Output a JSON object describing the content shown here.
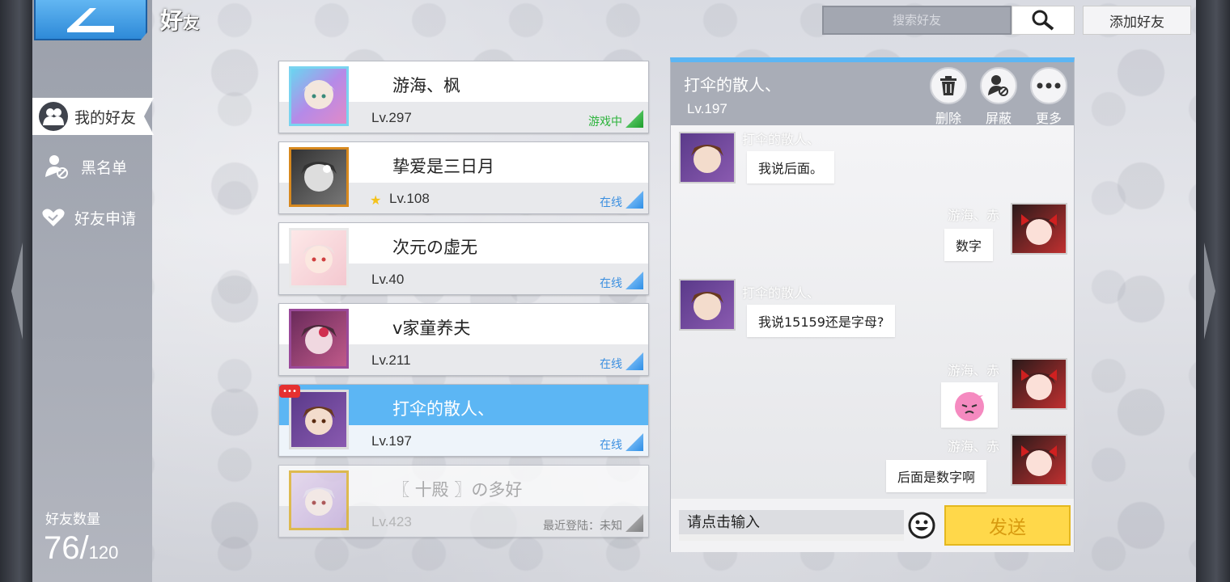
{
  "header": {
    "title_main": "好",
    "title_sub": "友",
    "search_placeholder": "搜索好友",
    "add_friend_label": "添加好友"
  },
  "sidebar": {
    "items": [
      {
        "label": "我的好友",
        "icon": "friends-icon",
        "active": true
      },
      {
        "label": "黑名单",
        "icon": "blacklist-icon",
        "active": false
      },
      {
        "label": "好友申请",
        "icon": "handshake-icon",
        "active": false
      }
    ],
    "count_label": "好友数量",
    "count_current": "76/",
    "count_max": "120"
  },
  "friends": [
    {
      "name": "游海、枫",
      "level": "Lv.297",
      "status": "游戏中",
      "status_type": "ingame",
      "avatar_color": "#8ad0e8"
    },
    {
      "name": "挚爱是三日月",
      "level": "Lv.108",
      "status": "在线",
      "status_type": "online",
      "avatar_color": "#555555",
      "star": "★"
    },
    {
      "name": "次元の虚无",
      "level": "Lv.40",
      "status": "在线",
      "status_type": "online",
      "avatar_color": "#f2d6d6"
    },
    {
      "name": "v家童养夫",
      "level": "Lv.211",
      "status": "在线",
      "status_type": "online",
      "avatar_color": "#a54a7a"
    },
    {
      "name": "打伞的散人、",
      "level": "Lv.197",
      "status": "在线",
      "status_type": "online",
      "avatar_color": "#8a5a3a",
      "selected": true,
      "badge": "•••"
    },
    {
      "name": "〖 十殿 〗の多好",
      "level": "Lv.423",
      "status": "最近登陆：未知",
      "status_type": "offline",
      "avatar_color": "#d8c8e8"
    }
  ],
  "chat": {
    "name": "打伞的散人、",
    "level": "Lv.197",
    "actions": [
      {
        "label": "删除",
        "icon": "trash-icon"
      },
      {
        "label": "屏蔽",
        "icon": "block-user-icon"
      },
      {
        "label": "更多",
        "icon": "more-icon"
      }
    ],
    "messages": [
      {
        "side": "left",
        "sender": "打伞的散人、",
        "text": "我说后面。"
      },
      {
        "side": "right",
        "sender": "游海、赤",
        "text": "数字"
      },
      {
        "side": "left",
        "sender": "打伞的散人、",
        "text": "我说15159还是字母?"
      },
      {
        "side": "right",
        "sender": "游海、赤",
        "text": "",
        "sticker": true
      },
      {
        "side": "right",
        "sender": "游海、赤",
        "text": "后面是数字啊"
      }
    ],
    "input_placeholder": "请点击输入",
    "send_label": "发送"
  },
  "colors": {
    "accent": "#5cb6f4",
    "online": "#3b8fe0",
    "ingame": "#2bb33a",
    "send": "#ffd84a"
  }
}
